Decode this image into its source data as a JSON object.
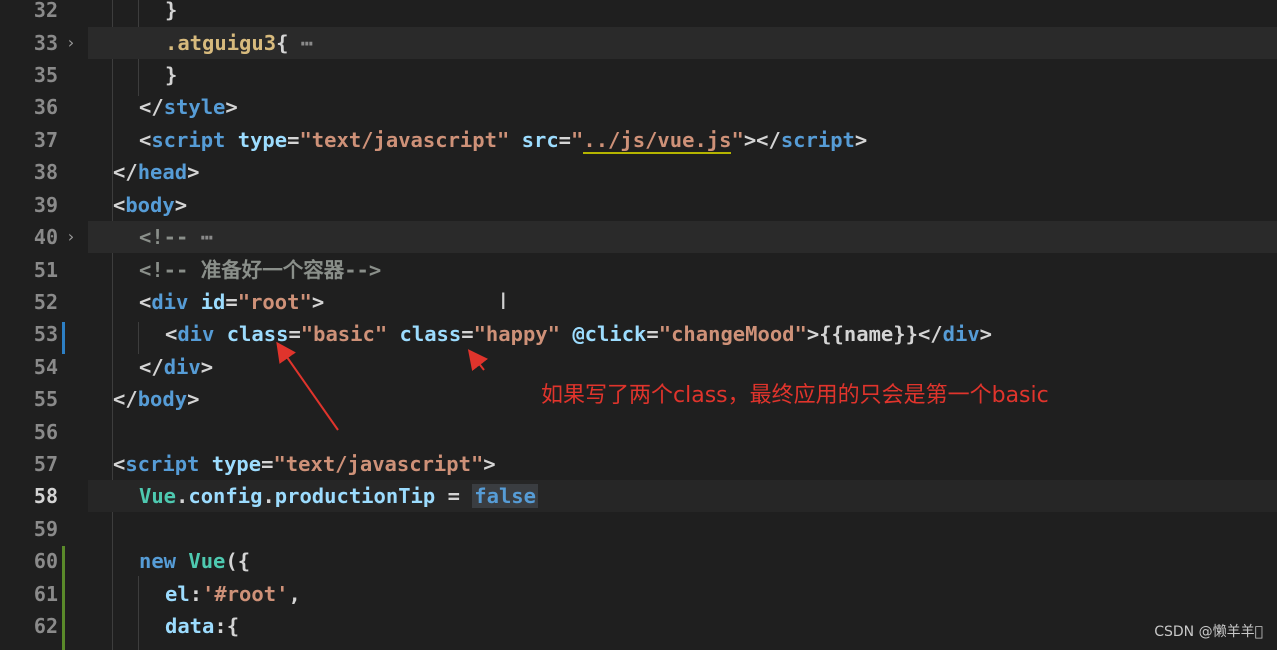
{
  "lines": [
    {
      "num": "32",
      "parts": [
        [
          "t-punct",
          "}"
        ]
      ]
    },
    {
      "num": "33",
      "parts": [
        [
          "t-sel",
          ".atguigu3"
        ],
        [
          "t-punct",
          "{"
        ],
        [
          "t-fold",
          " ⋯"
        ]
      ]
    },
    {
      "num": "35",
      "parts": [
        [
          "t-punct",
          "}"
        ]
      ]
    },
    {
      "num": "36",
      "parts": [
        [
          "t-punct",
          "</"
        ],
        [
          "t-tag",
          "style"
        ],
        [
          "t-punct",
          ">"
        ]
      ]
    },
    {
      "num": "37",
      "parts": [
        [
          "t-punct",
          "<"
        ],
        [
          "t-tag",
          "script"
        ],
        [
          "t-plain",
          " "
        ],
        [
          "t-attr",
          "type"
        ],
        [
          "t-punct",
          "="
        ],
        [
          "t-str",
          "\"text/javascript\""
        ],
        [
          "t-plain",
          " "
        ],
        [
          "t-attr",
          "src"
        ],
        [
          "t-punct",
          "="
        ],
        [
          "t-str",
          "\""
        ],
        [
          "t-str link-underline",
          "../js/vue.js"
        ],
        [
          "t-str",
          "\""
        ],
        [
          "t-punct",
          "></"
        ],
        [
          "t-tag",
          "script"
        ],
        [
          "t-punct",
          ">"
        ]
      ]
    },
    {
      "num": "38",
      "parts": [
        [
          "t-punct",
          "</"
        ],
        [
          "t-tag",
          "head"
        ],
        [
          "t-punct",
          ">"
        ]
      ]
    },
    {
      "num": "39",
      "parts": [
        [
          "t-punct",
          "<"
        ],
        [
          "t-tag",
          "body"
        ],
        [
          "t-punct",
          ">"
        ]
      ]
    },
    {
      "num": "40",
      "parts": [
        [
          "t-cmt",
          "<!-- "
        ],
        [
          "t-fold",
          "⋯"
        ]
      ]
    },
    {
      "num": "51",
      "parts": [
        [
          "t-cmt",
          "<!-- 准备好一个容器-->"
        ]
      ]
    },
    {
      "num": "52",
      "parts": [
        [
          "t-punct",
          "<"
        ],
        [
          "t-tag",
          "div"
        ],
        [
          "t-plain",
          " "
        ],
        [
          "t-attr",
          "id"
        ],
        [
          "t-punct",
          "="
        ],
        [
          "t-str",
          "\"root\""
        ],
        [
          "t-punct",
          ">"
        ]
      ]
    },
    {
      "num": "53",
      "parts": [
        [
          "t-punct",
          "<"
        ],
        [
          "t-tag",
          "div"
        ],
        [
          "t-plain",
          " "
        ],
        [
          "t-attr",
          "class"
        ],
        [
          "t-punct",
          "="
        ],
        [
          "t-str",
          "\"basic\""
        ],
        [
          "t-plain",
          " "
        ],
        [
          "t-attr",
          "class"
        ],
        [
          "t-punct",
          "="
        ],
        [
          "t-str",
          "\"happy\""
        ],
        [
          "t-plain",
          " "
        ],
        [
          "t-attr",
          "@click"
        ],
        [
          "t-punct",
          "="
        ],
        [
          "t-str",
          "\"changeMood\""
        ],
        [
          "t-punct",
          ">"
        ],
        [
          "t-plain",
          "{{name}}"
        ],
        [
          "t-punct",
          "</"
        ],
        [
          "t-tag",
          "div"
        ],
        [
          "t-punct",
          ">"
        ]
      ]
    },
    {
      "num": "54",
      "parts": [
        [
          "t-punct",
          "</"
        ],
        [
          "t-tag",
          "div"
        ],
        [
          "t-punct",
          ">"
        ]
      ]
    },
    {
      "num": "55",
      "parts": [
        [
          "t-punct",
          "</"
        ],
        [
          "t-tag",
          "body"
        ],
        [
          "t-punct",
          ">"
        ]
      ]
    },
    {
      "num": "56",
      "parts": []
    },
    {
      "num": "57",
      "parts": [
        [
          "t-punct",
          "<"
        ],
        [
          "t-tag",
          "script"
        ],
        [
          "t-plain",
          " "
        ],
        [
          "t-attr",
          "type"
        ],
        [
          "t-punct",
          "="
        ],
        [
          "t-str",
          "\"text/javascript\""
        ],
        [
          "t-punct",
          ">"
        ]
      ]
    },
    {
      "num": "58",
      "parts": [
        [
          "t-ident",
          "Vue"
        ],
        [
          "t-punct",
          "."
        ],
        [
          "t-prop",
          "config"
        ],
        [
          "t-punct",
          "."
        ],
        [
          "t-prop",
          "productionTip"
        ],
        [
          "t-plain",
          " = "
        ],
        [
          "t-bool false-box",
          "false"
        ]
      ]
    },
    {
      "num": "59",
      "parts": []
    },
    {
      "num": "60",
      "parts": [
        [
          "t-kw",
          "new"
        ],
        [
          "t-plain",
          " "
        ],
        [
          "t-ident",
          "Vue"
        ],
        [
          "t-punct",
          "({"
        ]
      ]
    },
    {
      "num": "61",
      "parts": [
        [
          "t-prop",
          "el"
        ],
        [
          "t-punct",
          ":"
        ],
        [
          "t-str",
          "'#root'"
        ],
        [
          "t-punct",
          ","
        ]
      ]
    },
    {
      "num": "62",
      "parts": [
        [
          "t-prop",
          "data"
        ],
        [
          "t-punct",
          ":{"
        ]
      ]
    }
  ],
  "annotation": {
    "text": "如果写了两个class，最终应用的只会是第一个basic"
  },
  "watermark": "CSDN @懒羊羊\u0000",
  "colors": {
    "background": "#1f1f1f",
    "annotation": "#e0342c"
  }
}
